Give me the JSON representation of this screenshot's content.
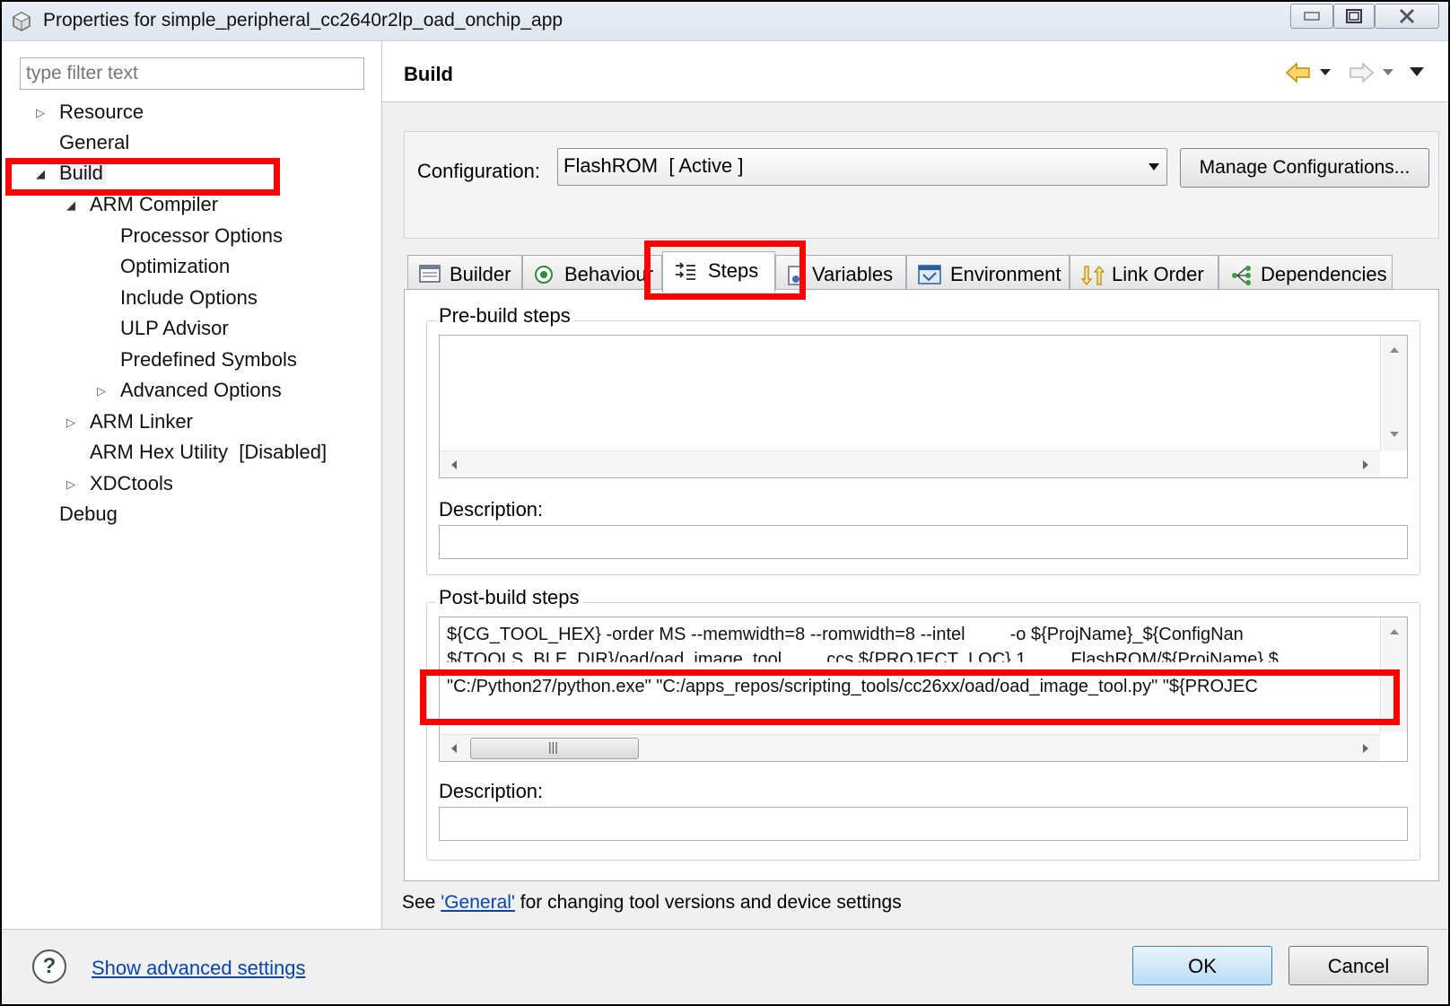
{
  "window": {
    "title": "Properties for simple_peripheral_cc2640r2lp_oad_onchip_app"
  },
  "filter": {
    "placeholder": "type filter text"
  },
  "tree": {
    "resource": "Resource",
    "general": "General",
    "build": "Build",
    "arm_compiler": "ARM Compiler",
    "processor_options": "Processor Options",
    "optimization": "Optimization",
    "include_options": "Include Options",
    "ulp_advisor": "ULP Advisor",
    "predefined_symbols": "Predefined Symbols",
    "advanced_options": "Advanced Options",
    "arm_linker": "ARM Linker",
    "arm_hex_utility": "ARM Hex Utility  [Disabled]",
    "xdctools": "XDCtools",
    "debug": "Debug"
  },
  "page": {
    "title": "Build"
  },
  "configuration": {
    "label": "Configuration:",
    "value": "FlashROM  [ Active ]",
    "manage_button": "Manage Configurations..."
  },
  "tabs": {
    "builder": "Builder",
    "behaviour": "Behaviour",
    "steps": "Steps",
    "variables": "Variables",
    "environment": "Environment",
    "link_order": "Link Order",
    "dependencies": "Dependencies"
  },
  "steps_tab": {
    "pre_build_label": "Pre-build steps",
    "pre_description_label": "Description:",
    "post_build_label": "Post-build steps",
    "post_description_label": "Description:",
    "post_build_lines": [
      "${CG_TOOL_HEX} -order MS --memwidth=8 --romwidth=8 --intel         -o ${ProjName}_${ConfigNan",
      "${TOOLS_BLE_DIR}/oad/oad_image_tool         ccs ${PROJECT_LOC} 1         FlashROM/${ProjName} $",
      "\"C:/Python27/python.exe\" \"C:/apps_repos/scripting_tools/cc26xx/oad/oad_image_tool.py\" \"${PROJEC"
    ]
  },
  "hint": {
    "prefix": "See ",
    "link": "'General'",
    "suffix": " for changing tool versions and device settings"
  },
  "footer": {
    "advanced_link": "Show advanced settings",
    "ok": "OK",
    "cancel": "Cancel"
  },
  "colors": {
    "highlight": "#ff0000",
    "link": "#0645ad"
  }
}
